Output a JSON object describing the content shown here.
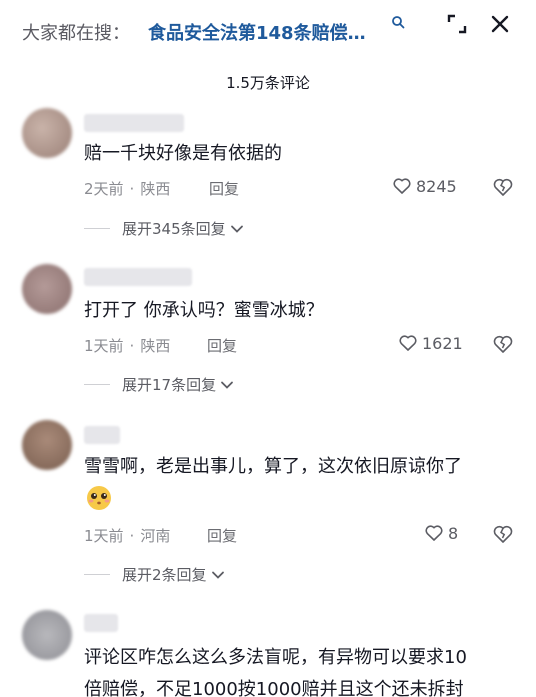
{
  "header": {
    "search_prefix": "大家都在搜：",
    "search_query": "食品安全法第148条赔偿…"
  },
  "comment_count": "1.5万条评论",
  "comments": [
    {
      "text": "赔一千块好像是有依据的",
      "time": "2天前",
      "location": "陕西",
      "reply_label": "回复",
      "likes": "8245",
      "expand_label": "展开345条回复"
    },
    {
      "text": "打开了  你承认吗？蜜雪冰城？",
      "time": "1天前",
      "location": "陕西",
      "reply_label": "回复",
      "likes": "1621",
      "expand_label": "展开17条回复"
    },
    {
      "text": "雪雪啊，老是出事儿，算了，这次依旧原谅你了",
      "time": "1天前",
      "location": "河南",
      "reply_label": "回复",
      "likes": "8",
      "expand_label": "展开2条回复"
    },
    {
      "text": "评论区咋怎么这么多法盲呢，有异物可以要求10",
      "text2": "倍赔偿，不足1000按1000赔并且这个还未拆封"
    }
  ],
  "icons": {
    "search": "search-icon",
    "minimize": "minimize-icon",
    "close": "close-icon",
    "like": "heart-icon",
    "dislike": "broken-heart-icon",
    "expand": "chevron-down-icon"
  },
  "colors": {
    "query_link": "#1f5a9c",
    "meta_gray": "#8a8b91"
  }
}
